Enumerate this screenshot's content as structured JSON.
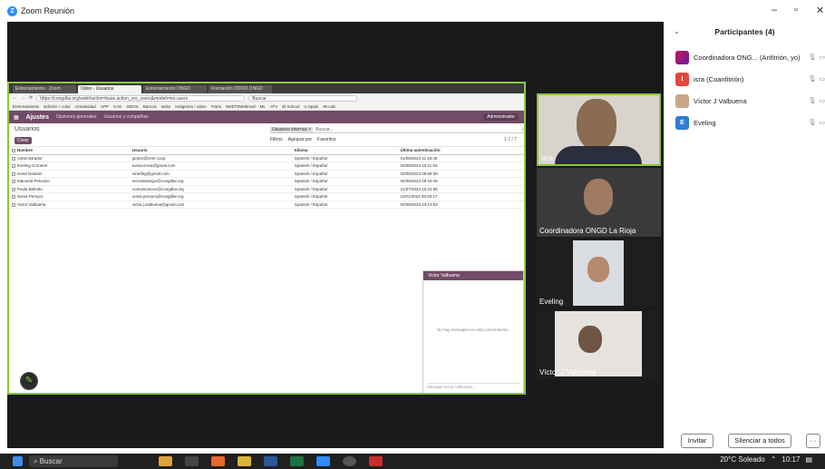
{
  "window": {
    "title": "Zoom Reunión",
    "logo_letter": "Z"
  },
  "browser": {
    "tabs": [
      "Entrenamiento · Zoom",
      "Odoo - Usuarios",
      "Entrenamiento ONGD",
      "Formación ODOO ONGD"
    ],
    "url": "https://congdlar.org/web#action=base.action_res_users&model=res.users",
    "search_placeholder": "Buscar",
    "bookmarks": [
      "Entrenamiento",
      "Edición + color",
      "Creatividad",
      "APP",
      "CAG",
      "ODOS",
      "Bancos",
      "webs",
      "Imágenes / video",
      "Trami",
      "WebTOWebmail",
      "ML",
      "ATV",
      "El School",
      "U.Spain",
      "IR-Lab"
    ]
  },
  "odoo": {
    "app": "Ajustes",
    "menu": [
      "Opciones generales",
      "Usuarios y compañías"
    ],
    "user": "Administrador",
    "breadcrumb": "Usuarios",
    "new_button": "Crear",
    "search_facet": "Usuarios internos ×",
    "search_placeholder": "Buscar...",
    "filters": [
      "Filtros",
      "Agrupar por",
      "Favoritos"
    ],
    "pager": "1-7 / 7",
    "columns": [
      "Nombre",
      "Usuario",
      "Idioma",
      "Última autenticación"
    ],
    "rows": [
      [
        "Administrador",
        "gestor@ceer.coop",
        "Spanish / Español",
        "01/08/2023 11:48:45"
      ],
      [
        "Eveling Cornerer",
        "eveacorrea@gmail.com",
        "Spanish / Español",
        "02/08/2023 10:11:53"
      ],
      [
        "Israel Dolanin",
        "israelbg@gmail.com",
        "Spanish / Español",
        "02/08/2023 09:58:39"
      ],
      [
        "Manuela Pelusino",
        "secretariango@congdlar.org",
        "Spanish / Español",
        "02/08/2023 09:18:48"
      ],
      [
        "Paula Bellotto",
        "comunicacion@congdlar.org",
        "Spanish / Español",
        "21/07/2023 16:21:58"
      ],
      [
        "Sonia Pereyro",
        "sonia.pereyro@congdlar.org",
        "Spanish / Español",
        "11/01/2023 09:20:17"
      ],
      [
        "Victor Valbuena",
        "victor.j.valbuena@gmail.com",
        "Spanish / Español",
        "02/08/2023 10:13:53"
      ]
    ],
    "chat": {
      "title": "Victor Valbuena",
      "empty": "No hay mensajes en esta conversación.",
      "input_placeholder": "Mensaje Victor Valbuena..."
    }
  },
  "videos": [
    {
      "name": "isra"
    },
    {
      "name": "Coordinadora ONGD La Rioja"
    },
    {
      "name": "Eveling"
    },
    {
      "name": "Víctor J Valbuena"
    }
  ],
  "participants": {
    "header": "Participantes (4)",
    "list": [
      {
        "name": "Coordinadora ONG... (Anfitrión, yo)",
        "avatar": "",
        "color": "#ffffff"
      },
      {
        "name": "isra (Coanfitrión)",
        "avatar": "I",
        "color": "#e0483e"
      },
      {
        "name": "Víctor J Valbuena",
        "avatar": "",
        "color": "#c9a888"
      },
      {
        "name": "Eveling",
        "avatar": "E",
        "color": "#2d7dd2"
      }
    ],
    "invite": "Invitar",
    "mute_all": "Silenciar a todos",
    "more": "···"
  },
  "taskbar": {
    "search": "Buscar",
    "weather": "20°C Soleado",
    "time": "10:17"
  }
}
